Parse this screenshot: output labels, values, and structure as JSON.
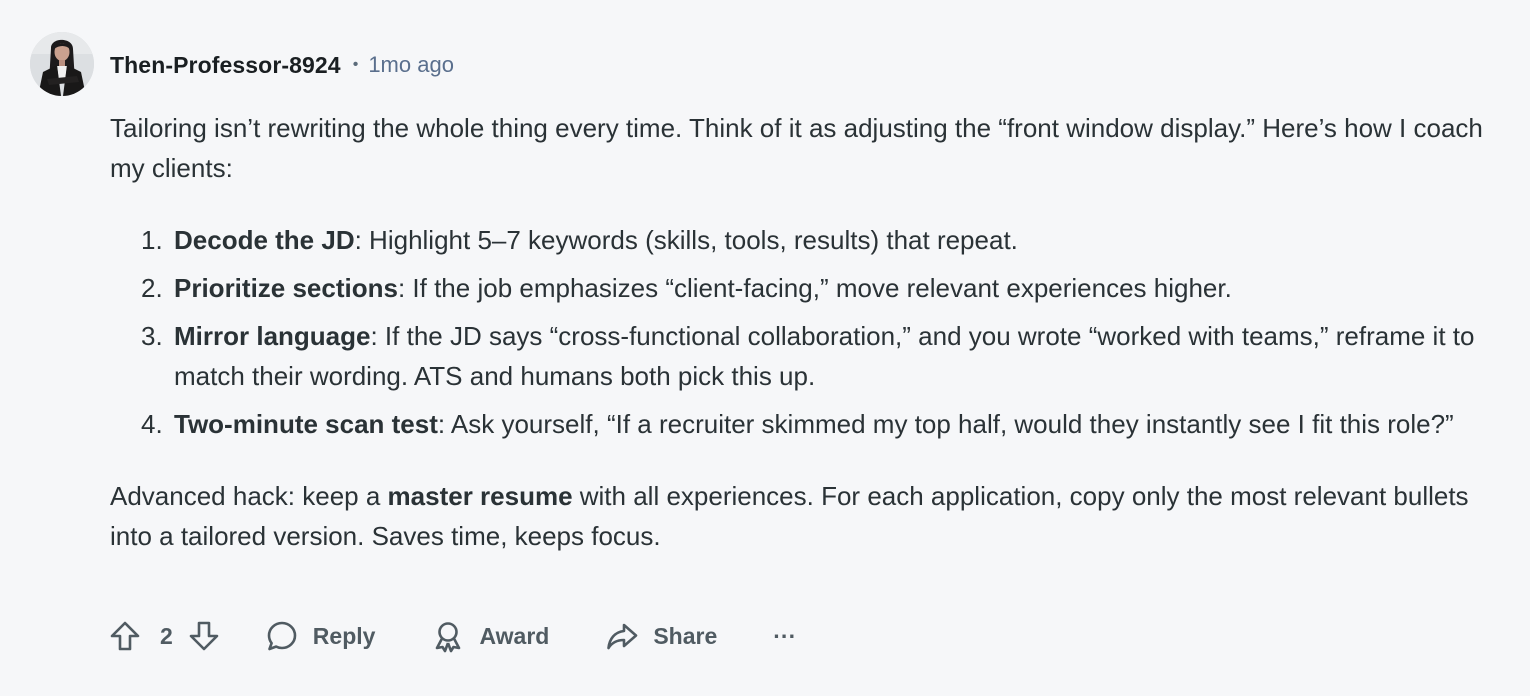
{
  "comment": {
    "username": "Then-Professor-8924",
    "separator": "•",
    "timestamp": "1mo ago",
    "intro": "Tailoring isn’t rewriting the whole thing every time. Think of it as adjusting the “front window display.” Here’s how I coach my clients:",
    "steps": [
      {
        "number": "1.",
        "title": "Decode the JD",
        "text": ": Highlight 5–7 keywords (skills, tools, results) that repeat."
      },
      {
        "number": "2.",
        "title": "Prioritize sections",
        "text": ": If the job emphasizes “client-facing,” move relevant experiences higher."
      },
      {
        "number": "3.",
        "title": "Mirror language",
        "text": ": If the JD says “cross-functional collaboration,” and you wrote “worked with teams,” reframe it to match their wording. ATS and humans both pick this up."
      },
      {
        "number": "4.",
        "title": "Two-minute scan test",
        "text": ": Ask yourself, “If a recruiter skimmed my top half, would they instantly see I fit this role?”"
      }
    ],
    "outro": {
      "before": "Advanced hack: keep a ",
      "bold": "master resume",
      "after": " with all experiences. For each application, copy only the most relevant bullets into a tailored version. Saves time, keeps focus."
    }
  },
  "actions": {
    "upvote_icon": "arrow-up-icon",
    "vote_count": "2",
    "downvote_icon": "arrow-down-icon",
    "reply_label": "Reply",
    "reply_icon": "speech-bubble-icon",
    "award_label": "Award",
    "award_icon": "award-ribbon-icon",
    "share_label": "Share",
    "share_icon": "share-arrow-icon",
    "more_label": "···"
  },
  "colors": {
    "background": "#f6f7f9",
    "text": "#2a3236",
    "timestamp": "#5a6f8d",
    "action": "#505b62"
  }
}
